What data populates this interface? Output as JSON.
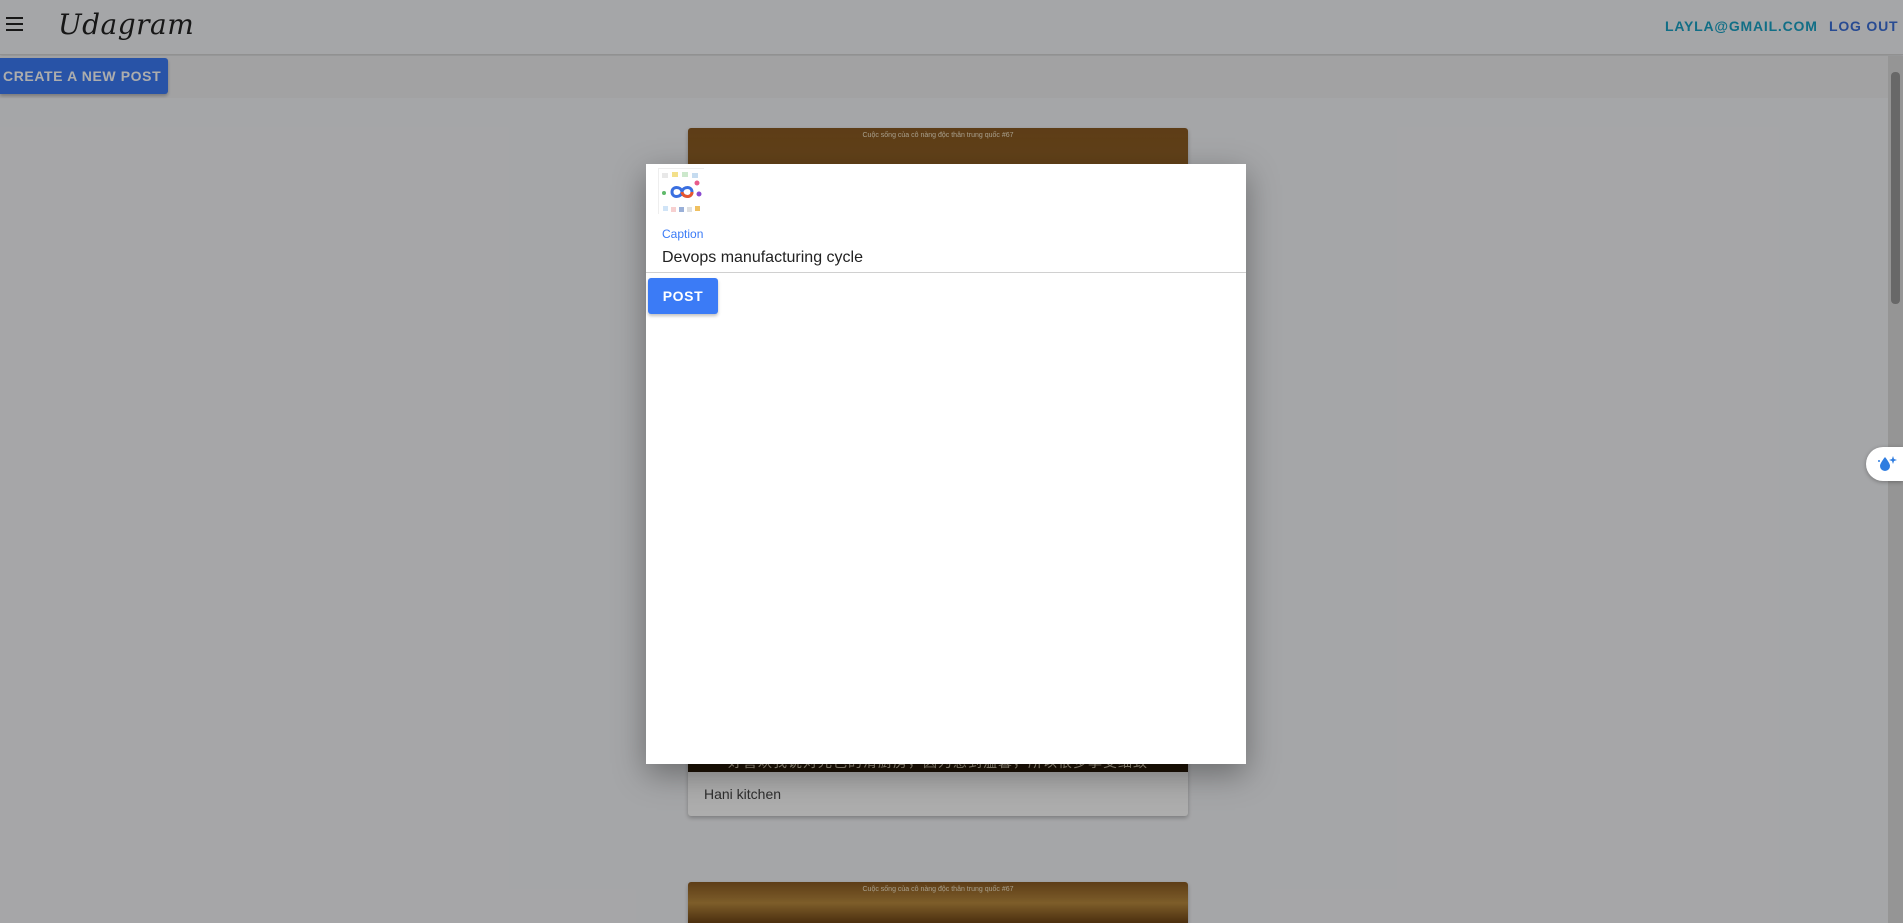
{
  "header": {
    "brand": "Udagram",
    "user_email": "LAYLA@GMAIL.COM",
    "logout_label": "LOG OUT"
  },
  "actions": {
    "create_post_label": "CREATE A NEW POST"
  },
  "feed": {
    "items": [
      {
        "image_top_caption": "Cuộc sống của cô nàng độc thân trung quốc #67",
        "image_sub_caption": "好喜欢我说对光色的滑厨房，因为感到温馨，所以很多享受细致",
        "caption": "Hani kitchen"
      },
      {
        "image_top_caption": "Cuộc sống của cô nàng độc thân trung quốc #67"
      }
    ]
  },
  "modal": {
    "caption_label": "Caption",
    "caption_value": "Devops manufacturing cycle",
    "post_label": "POST"
  },
  "colors": {
    "primary": "#3b7bf6",
    "email_link": "#1aa3c6",
    "logout_link": "#3b6fd8"
  }
}
